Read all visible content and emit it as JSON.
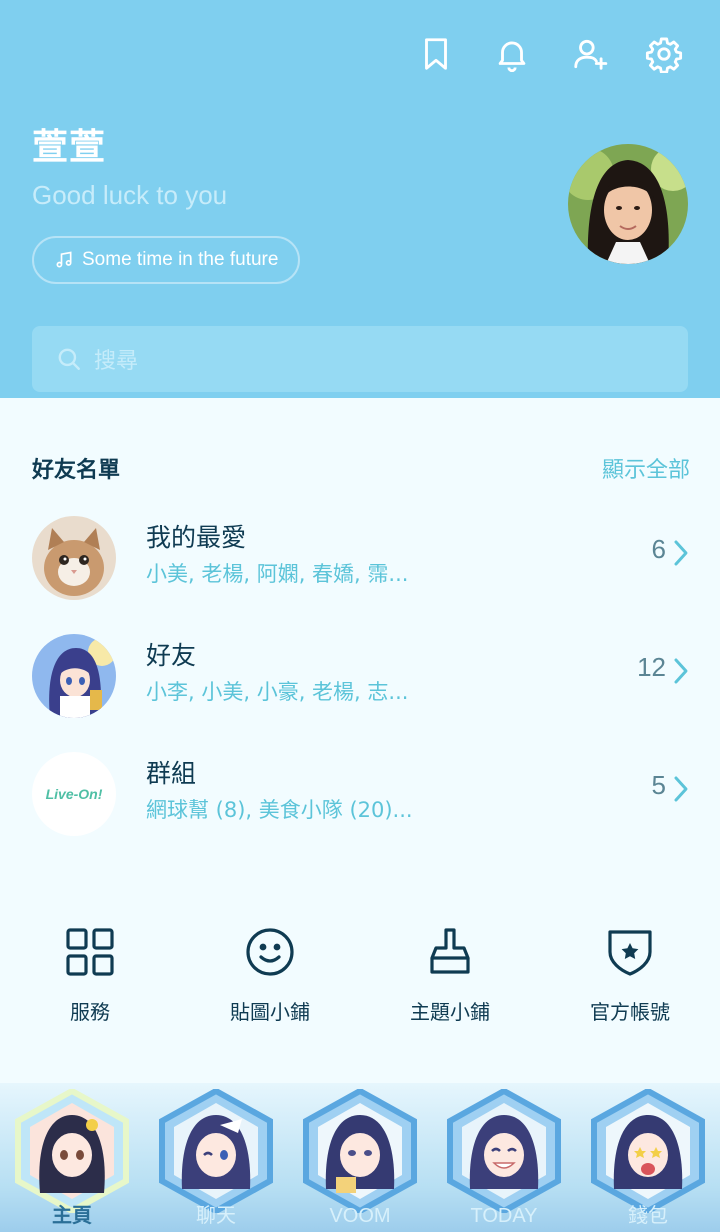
{
  "header": {
    "name": "萱萱",
    "status_message": "Good luck to you",
    "music": "Some time in the future",
    "icons": [
      "bookmark-icon",
      "bell-icon",
      "add-friend-icon",
      "settings-icon"
    ]
  },
  "search": {
    "placeholder": "搜尋"
  },
  "friends_section": {
    "title": "好友名單",
    "show_all": "顯示全部",
    "rows": [
      {
        "title": "我的最愛",
        "subtitle": "小美, 老楊, 阿嫻, 春嬌, 霈...",
        "count": "6"
      },
      {
        "title": "好友",
        "subtitle": "小李, 小美, 小豪, 老楊, 志...",
        "count": "12"
      },
      {
        "title": "群組",
        "subtitle": "網球幫 (8), 美食小隊 (20)...",
        "count": "5",
        "avatar_logo": "Live-On!"
      }
    ]
  },
  "services": [
    {
      "label": "服務",
      "icon": "grid-icon"
    },
    {
      "label": "貼圖小鋪",
      "icon": "smiley-icon"
    },
    {
      "label": "主題小鋪",
      "icon": "brush-icon"
    },
    {
      "label": "官方帳號",
      "icon": "shield-star-icon"
    }
  ],
  "bottom_nav": [
    {
      "label": "主頁",
      "active": true
    },
    {
      "label": "聊天",
      "active": false
    },
    {
      "label": "VOOM",
      "active": false
    },
    {
      "label": "TODAY",
      "active": false
    },
    {
      "label": "錢包",
      "active": false
    }
  ],
  "colors": {
    "header_bg": "#7fcfef",
    "body_bg": "#f2fcff",
    "accent": "#5cc4d9",
    "dark_text": "#0f3b52"
  }
}
